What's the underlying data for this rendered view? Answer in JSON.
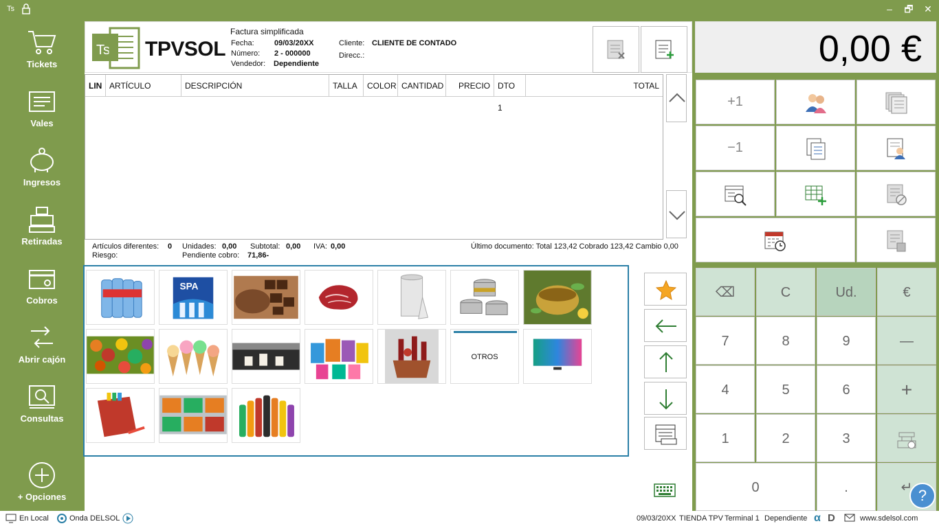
{
  "window": {
    "app_badge": "Ts",
    "minimize": "–",
    "restore": "🗗",
    "close": "✕"
  },
  "sidebar": {
    "items": [
      {
        "label": "Tickets"
      },
      {
        "label": "Vales"
      },
      {
        "label": "Ingresos"
      },
      {
        "label": "Retiradas"
      },
      {
        "label": "Cobros"
      },
      {
        "label": "Abrir cajón"
      },
      {
        "label": "Consultas"
      },
      {
        "label": "+ Opciones"
      }
    ]
  },
  "header": {
    "brand": "TPVSOL",
    "logo_text": "Ts",
    "doc_type": "Factura simplificada",
    "fecha_label": "Fecha:",
    "fecha": "09/03/20XX",
    "numero_label": "Número:",
    "numero": "2 - 000000",
    "vendedor_label": "Vendedor:",
    "vendedor": "Dependiente",
    "cliente_label": "Cliente:",
    "cliente": "CLIENTE DE CONTADO",
    "direcc_label": "Direcc.:"
  },
  "table": {
    "columns": [
      "LIN",
      "ARTÍCULO",
      "DESCRIPCIÓN",
      "TALLA",
      "COLOR",
      "CANTIDAD",
      "PRECIO",
      "DTO 1",
      "TOTAL"
    ],
    "rows": []
  },
  "totals": {
    "art_dif_label": "Artículos diferentes:",
    "art_dif": "0",
    "unidades_label": "Unidades:",
    "unidades": "0,00",
    "subtotal_label": "Subtotal:",
    "subtotal": "0,00",
    "iva_label": "IVA:",
    "iva": "0,00",
    "riesgo_label": "Riesgo:",
    "pendiente_label": "Pendiente cobro:",
    "pendiente": "71,86-",
    "ultimo": "Último documento: Total 123,42 Cobrado 123,42 Cambio 0,00"
  },
  "categories": [
    {
      "name": "water-bottles",
      "label": ""
    },
    {
      "name": "spa-water",
      "label": ""
    },
    {
      "name": "chocolate",
      "label": ""
    },
    {
      "name": "meat",
      "label": ""
    },
    {
      "name": "paper-roll",
      "label": ""
    },
    {
      "name": "tins",
      "label": ""
    },
    {
      "name": "tea",
      "label": ""
    },
    {
      "name": "fruits",
      "label": ""
    },
    {
      "name": "ice-cream",
      "label": ""
    },
    {
      "name": "coffee",
      "label": ""
    },
    {
      "name": "cleaning",
      "label": ""
    },
    {
      "name": "gift-basket",
      "label": ""
    },
    {
      "name": "otros",
      "label": "OTROS"
    },
    {
      "name": "tvs",
      "label": ""
    },
    {
      "name": "stationery",
      "label": ""
    },
    {
      "name": "food-trays",
      "label": ""
    },
    {
      "name": "soft-drinks",
      "label": ""
    }
  ],
  "display": {
    "amount": "0,00 €"
  },
  "functions": {
    "plus_one": "+1",
    "minus_one": "−1"
  },
  "keypad": {
    "backspace": "⌫",
    "clear": "C",
    "unit": "Ud.",
    "euro": "€",
    "k7": "7",
    "k8": "8",
    "k9": "9",
    "minus": "—",
    "k4": "4",
    "k5": "5",
    "k6": "6",
    "plus": "+",
    "k1": "1",
    "k2": "2",
    "k3": "3",
    "k0": "0",
    "dot": ".",
    "enter": "↵"
  },
  "status": {
    "local": "En Local",
    "onda": "Onda DELSOL",
    "date": "09/03/20XX",
    "tienda": "TIENDA TPV",
    "terminal": "Terminal 1",
    "user": "Dependiente",
    "web": "www.sdelsol.com"
  },
  "colors": {
    "sidebar": "#7f9b4d",
    "keypad_green": "#cfe3d4",
    "frame": "#2a7fa6"
  }
}
